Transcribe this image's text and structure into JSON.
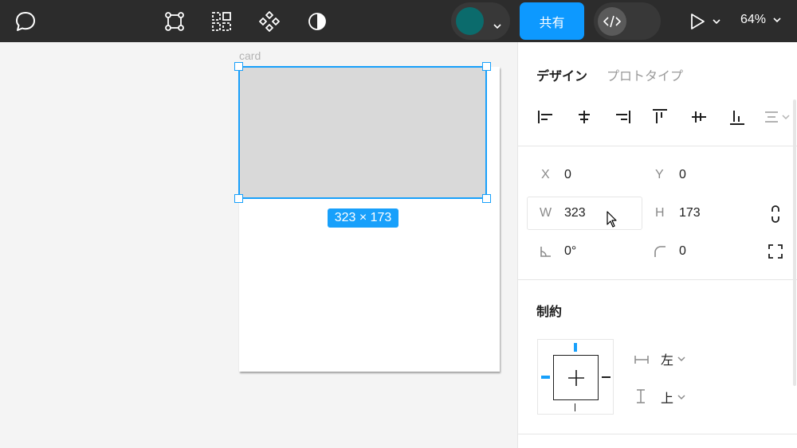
{
  "toolbar": {
    "share_label": "共有",
    "zoom_label": "64%",
    "icons": [
      "comment-icon",
      "frame-tool-icon",
      "component-grid-icon",
      "component-icon",
      "contrast-icon",
      "code-icon",
      "play-icon"
    ],
    "avatar_color": "#0b6b6c",
    "accent": "#0d99ff"
  },
  "canvas": {
    "frame_name": "card",
    "selection_size": "323 × 173"
  },
  "panel": {
    "tabs": [
      "デザイン",
      "プロトタイプ"
    ],
    "x_label": "X",
    "x_value": "0",
    "y_label": "Y",
    "y_value": "0",
    "w_label": "W",
    "w_value": "323",
    "h_label": "H",
    "h_value": "173",
    "rotation_value": "0°",
    "radius_value": "0",
    "constraints_title": "制約",
    "horizontal_constraint": "左",
    "vertical_constraint": "上"
  }
}
